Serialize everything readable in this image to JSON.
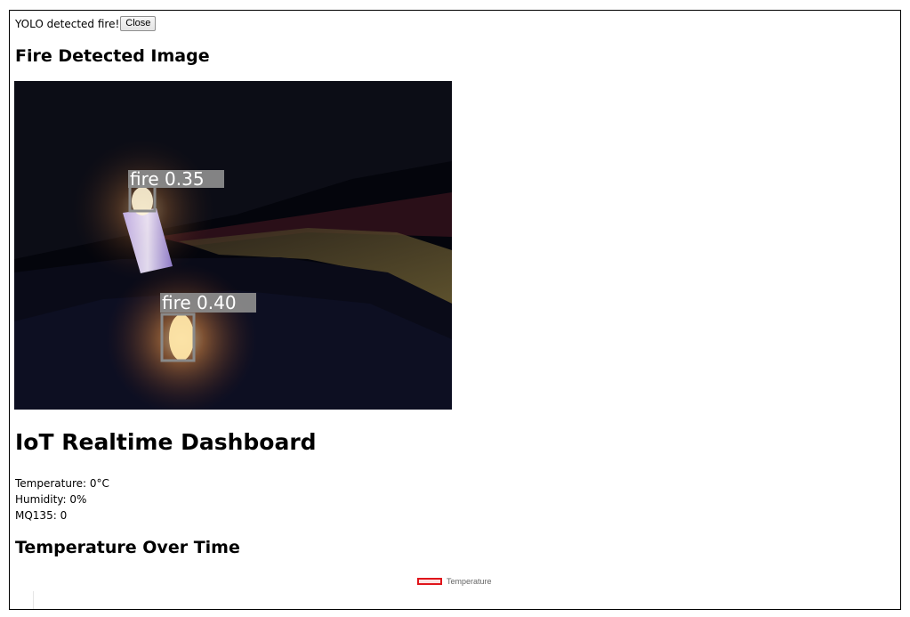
{
  "alert": {
    "message": "YOLO detected fire!",
    "close_label": "Close"
  },
  "fire_section": {
    "title": "Fire Detected Image",
    "detections": [
      {
        "label": "fire",
        "confidence": "0.35"
      },
      {
        "label": "fire",
        "confidence": "0.40"
      }
    ]
  },
  "dashboard": {
    "title": "IoT Realtime Dashboard",
    "temperature_label": "Temperature: ",
    "temperature_value": "0°C",
    "humidity_label": "Humidity: ",
    "humidity_value": "0%",
    "mq135_label": "MQ135: ",
    "mq135_value": "0"
  },
  "temperature_chart": {
    "title": "Temperature Over Time",
    "legend_label": "Temperature",
    "legend_color": "#e0151b"
  }
}
